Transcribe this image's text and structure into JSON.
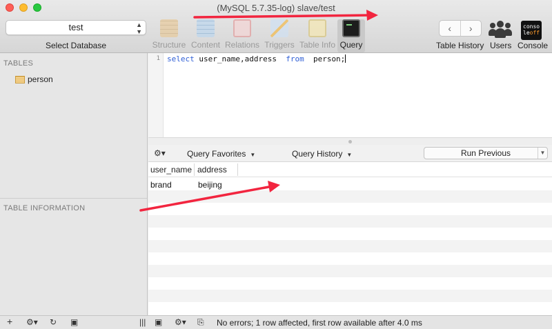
{
  "window": {
    "title": "(MySQL 5.7.35-log) slave/test"
  },
  "toolbar": {
    "database_select": {
      "value": "test",
      "label": "Select Database"
    },
    "tools": [
      {
        "label": "Structure",
        "icon": "structure-icon",
        "active": false
      },
      {
        "label": "Content",
        "icon": "content-icon",
        "active": false
      },
      {
        "label": "Relations",
        "icon": "relations-icon",
        "active": false
      },
      {
        "label": "Triggers",
        "icon": "triggers-icon",
        "active": false
      },
      {
        "label": "Table Info",
        "icon": "table-info-icon",
        "active": false
      },
      {
        "label": "Query",
        "icon": "query-icon",
        "active": true
      }
    ],
    "history": {
      "back_glyph": "‹",
      "forward_glyph": "›",
      "label": "Table History"
    },
    "users": {
      "label": "Users",
      "icon": "users-icon"
    },
    "console": {
      "label": "Console",
      "icon": "console-icon",
      "icon_text_1": "conso",
      "icon_text_2": "le",
      "icon_text_off": "off"
    }
  },
  "sidebar": {
    "tables_header": "TABLES",
    "tables": [
      {
        "name": "person",
        "icon": "table-icon"
      }
    ],
    "info_header": "TABLE INFORMATION"
  },
  "editor": {
    "line_number": "1",
    "tokens": [
      {
        "text": "select",
        "keyword": true
      },
      {
        "text": " user_name,address  ",
        "keyword": false
      },
      {
        "text": "from",
        "keyword": true
      },
      {
        "text": "  person;",
        "keyword": false
      }
    ]
  },
  "results_toolbar": {
    "gear_icon": "gear-icon",
    "query_favorites": "Query Favorites",
    "query_history": "Query History",
    "run_previous": "Run Previous"
  },
  "results": {
    "columns": [
      "user_name",
      "address"
    ],
    "rows": [
      [
        "brand",
        "beijing"
      ]
    ]
  },
  "statusbar": {
    "message": "No errors; 1 row affected, first row available after 4.0 ms",
    "icons": [
      "add-icon",
      "gear-icon",
      "refresh-icon",
      "filter-icon",
      "split-icon",
      "image-icon",
      "gear-icon",
      "copy-icon"
    ]
  },
  "annotation_color": "#f2253f"
}
